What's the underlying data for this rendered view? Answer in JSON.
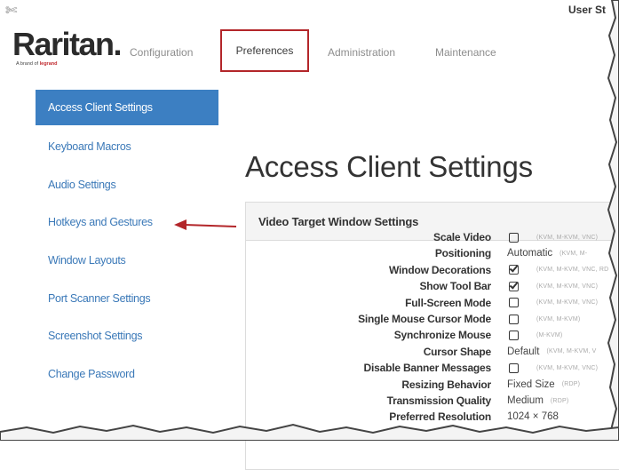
{
  "header": {
    "user_status": "User St"
  },
  "logo": {
    "text": "Raritan",
    "dot": ".",
    "sub_prefix": "A brand of ",
    "sub_brand": "legrand"
  },
  "nav": {
    "tabs": [
      {
        "label": "Configuration"
      },
      {
        "label": "Preferences"
      },
      {
        "label": "Administration"
      },
      {
        "label": "Maintenance"
      }
    ]
  },
  "sidebar": {
    "items": [
      {
        "label": "Access Client Settings",
        "active": true
      },
      {
        "label": "Keyboard Macros"
      },
      {
        "label": "Audio Settings"
      },
      {
        "label": "Hotkeys and Gestures"
      },
      {
        "label": "Window Layouts"
      },
      {
        "label": "Port Scanner Settings"
      },
      {
        "label": "Screenshot Settings"
      },
      {
        "label": "Change Password"
      }
    ]
  },
  "main": {
    "title": "Access Client Settings",
    "panel_title": "Video Target Window Settings",
    "settings": [
      {
        "label": "Scale Video",
        "control": "checkbox",
        "checked": false,
        "tag": "(KVM, M-KVM, VNC)"
      },
      {
        "label": "Positioning",
        "value": "Automatic",
        "tag": "(KVM, M-"
      },
      {
        "label": "Window Decorations",
        "control": "checkbox",
        "checked": true,
        "tag": "(KVM, M-KVM, VNC, RD"
      },
      {
        "label": "Show Tool Bar",
        "control": "checkbox",
        "checked": true,
        "tag": "(KVM, M-KVM, VNC)"
      },
      {
        "label": "Full-Screen Mode",
        "control": "checkbox",
        "checked": false,
        "tag": "(KVM, M-KVM, VNC)"
      },
      {
        "label": "Single Mouse Cursor Mode",
        "control": "checkbox",
        "checked": false,
        "tag": "(KVM, M-KVM)"
      },
      {
        "label": "Synchronize Mouse",
        "control": "checkbox",
        "checked": false,
        "tag": "(M-KVM)"
      },
      {
        "label": "Cursor Shape",
        "value": "Default",
        "tag": "(KVM, M-KVM, V"
      },
      {
        "label": "Disable Banner Messages",
        "control": "checkbox",
        "checked": false,
        "tag": "(KVM, M-KVM, VNC)"
      },
      {
        "label": "Resizing Behavior",
        "value": "Fixed Size",
        "tag": "(RDP)"
      },
      {
        "label": "Transmission Quality",
        "value": "Medium",
        "tag": "(RDP)"
      },
      {
        "label": "Preferred Resolution",
        "value": "1024 × 768"
      }
    ]
  },
  "colors": {
    "accent": "#3c7fc2",
    "highlight_border": "#b3262a",
    "arrow": "#b3262a",
    "link": "#3b79b8"
  },
  "icons": {
    "corner": "tools-icon",
    "arrow": "left-arrow-annotation-icon"
  }
}
